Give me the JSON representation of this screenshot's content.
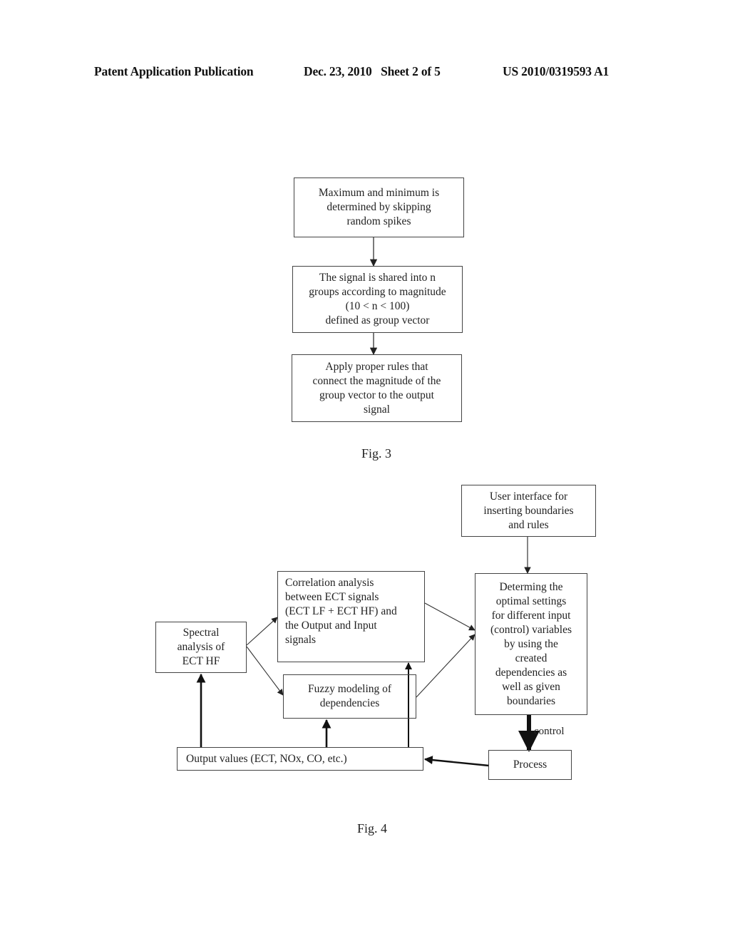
{
  "header": {
    "left": "Patent Application Publication",
    "middle": "Dec. 23, 2010   Sheet 2 of 5",
    "right": "US 2010/0319593 A1"
  },
  "fig3": {
    "caption": "Fig. 3",
    "boxes": [
      {
        "id": "max-min",
        "text": "Maximum and minimum is\ndetermined by skipping\nrandom spikes"
      },
      {
        "id": "signal-groups",
        "text": "The signal is shared into n\ngroups according to magnitude\n(10 < n < 100)\ndefined as group vector"
      },
      {
        "id": "apply-rules",
        "text": "Apply proper rules that\nconnect the magnitude of the\ngroup vector to the output\nsignal"
      }
    ]
  },
  "fig4": {
    "caption": "Fig. 4",
    "boxes": {
      "user_interface": "User interface for\ninserting boundaries\nand rules",
      "correlation": "Correlation analysis\nbetween ECT signals\n(ECT LF + ECT HF) and\nthe Output and Input\nsignals",
      "spectral": "Spectral\nanalysis of\nECT HF",
      "fuzzy": "Fuzzy modeling of\ndependencies",
      "determining": "Determing the\noptimal settings\nfor different input\n(control) variables\nby using the\ncreated\ndependencies as\nwell as given\nboundaries",
      "output_values": "Output values (ECT, NOx, CO, etc.)",
      "process": "Process"
    },
    "control_label": "control"
  }
}
